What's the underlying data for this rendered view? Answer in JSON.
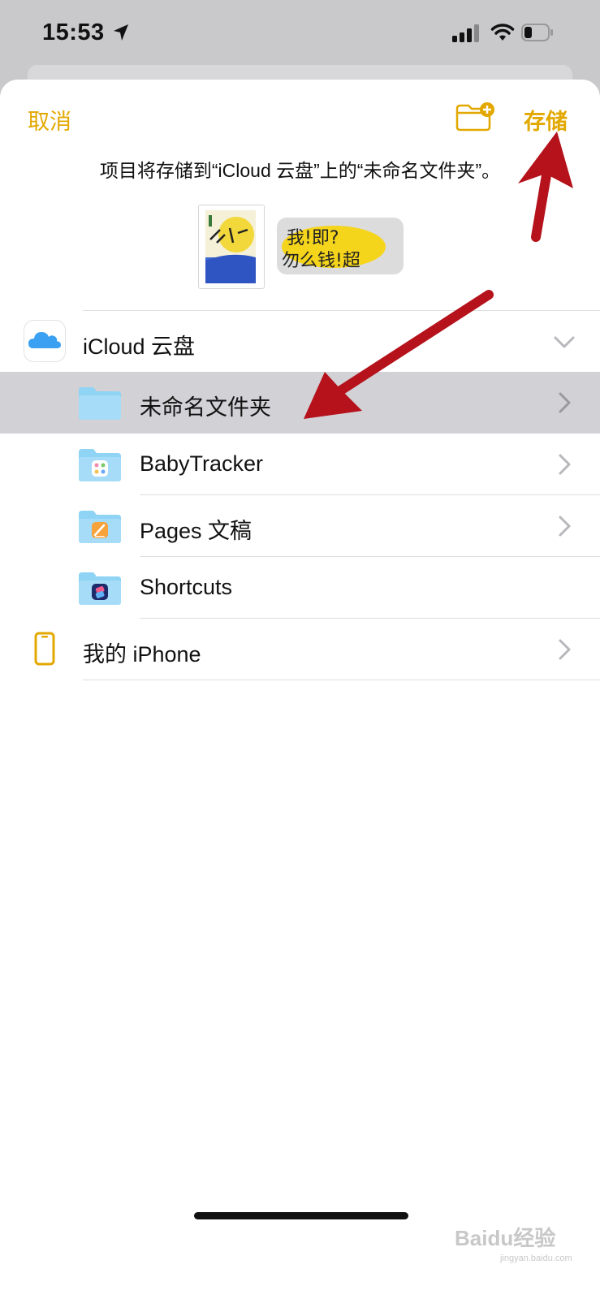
{
  "status_bar": {
    "time": "15:53",
    "icons": [
      "location-arrow-icon",
      "cellular-signal-icon",
      "wifi-icon",
      "battery-icon"
    ]
  },
  "header": {
    "cancel_label": "取消",
    "new_folder_icon": "folder-plus-icon",
    "save_label": "存储"
  },
  "subtitle": "项目将存储到“iCloud 云盘”上的“未命名文件夹”。",
  "locations": {
    "icloud": {
      "label": "iCloud 云盘",
      "icon": "icloud-icon",
      "expanded": true
    },
    "folders": [
      {
        "label": "未命名文件夹",
        "icon": "folder-icon",
        "selected": true,
        "has_chevron": true
      },
      {
        "label": "BabyTracker",
        "icon": "babytracker-folder-icon",
        "selected": false,
        "has_chevron": true
      },
      {
        "label": "Pages 文稿",
        "icon": "pages-folder-icon",
        "selected": false,
        "has_chevron": true
      },
      {
        "label": "Shortcuts",
        "icon": "shortcuts-folder-icon",
        "selected": false,
        "has_chevron": false
      }
    ],
    "iphone": {
      "label": "我的 iPhone",
      "icon": "iphone-icon",
      "has_chevron": true
    }
  },
  "thumbnails": {
    "image_text_line1": "我!即?",
    "image_text_line2": "勿么钱!超"
  },
  "watermark": {
    "text": "Baidu经验",
    "sub": "jingyan.baidu.com"
  },
  "colors": {
    "accent": "#e3a800",
    "selected_row": "#d1d1d6",
    "folder": "#8fd3f5",
    "annotation_arrow": "#b5121b"
  }
}
